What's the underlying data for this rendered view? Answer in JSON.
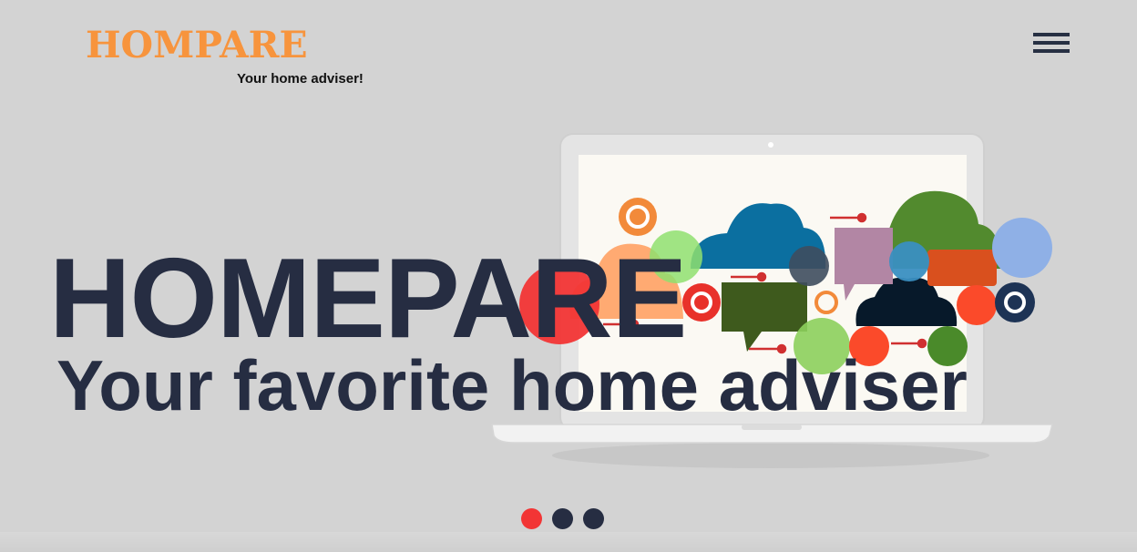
{
  "header": {
    "logo_text": "HOMPARE",
    "logo_tagline": "Your home adviser!",
    "menu_icon": "hamburger-menu-icon"
  },
  "hero": {
    "title": "HOMEPARE",
    "subtitle": "Your favorite home adviser",
    "illustration": "laptop-with-speech-bubbles-illustration"
  },
  "slider": {
    "dots": [
      "slide 1",
      "slide 2",
      "slide 3"
    ],
    "active_index": 0
  },
  "colors": {
    "background": "#d3d3d3",
    "brand_orange": "#f7943d",
    "heading_navy": "#262d42",
    "active_dot_red": "#f23535"
  }
}
